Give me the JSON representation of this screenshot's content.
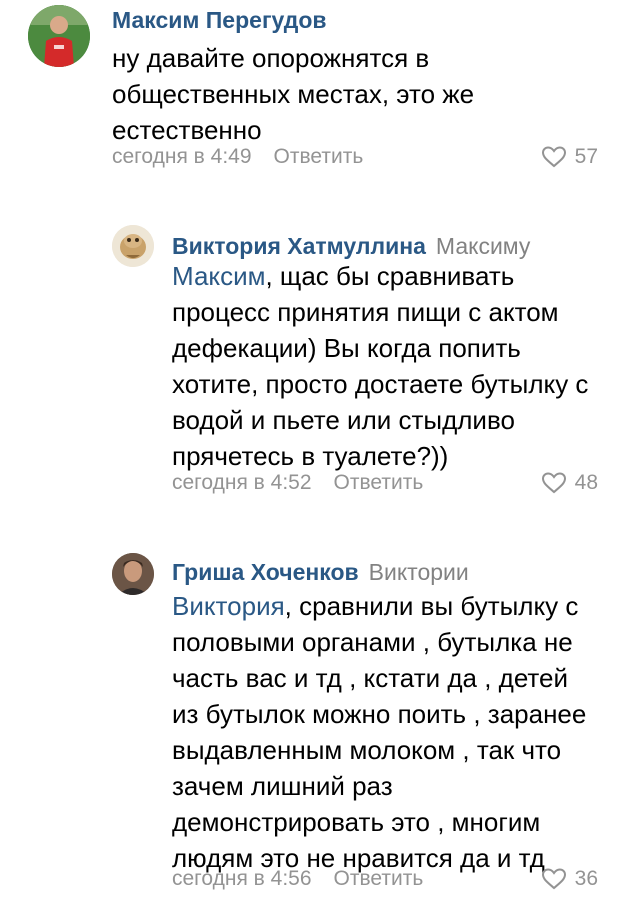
{
  "comments": [
    {
      "author": "Максим Перегудов",
      "reply_to": "",
      "mention": "",
      "lines": [
        "ну давайте опорожнятся в",
        "общественных местах, это же",
        "естественно"
      ],
      "time": "сегодня в 4:49",
      "reply_label": "Ответить",
      "likes": "57",
      "avatar_icon": "user-avatar-red-shirt"
    },
    {
      "author": "Виктория Хатмуллина",
      "reply_to": "Максиму",
      "mention": "Максим",
      "first_line_rest": ", щас бы сравнивать",
      "lines": [
        "процесс принятия пищи с актом",
        "дефекации) Вы когда попить",
        "хотите, просто достаете бутылку с",
        "водой и пьете или стыдливо",
        "прячетесь в туалете?))"
      ],
      "time": "сегодня в 4:52",
      "reply_label": "Ответить",
      "likes": "48",
      "avatar_icon": "user-avatar-cartoon"
    },
    {
      "author": "Гриша Хоченков",
      "reply_to": "Виктории",
      "mention": "Виктория",
      "first_line_rest": ", сравнили вы бутылку с",
      "lines": [
        "половыми органами , бутылка не",
        "часть вас и тд , кстати да , детей",
        "из бутылок можно поить , заранее",
        "выдавленным молоком , так что",
        "зачем лишний раз",
        "демонстрировать это , многим",
        "людям это не нравится да и тд"
      ],
      "time": "сегодня в 4:56",
      "reply_label": "Ответить",
      "likes": "36",
      "avatar_icon": "user-avatar-photo"
    }
  ],
  "colors": {
    "author": "#2a5885",
    "meta": "#939393",
    "text": "#000000"
  }
}
